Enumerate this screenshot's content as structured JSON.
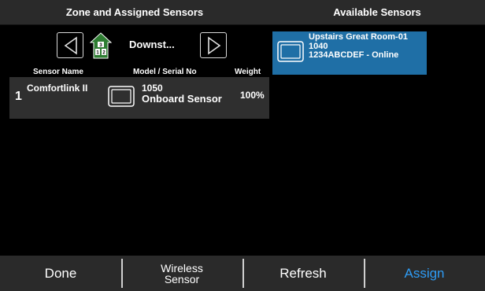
{
  "headers": {
    "left": "Zone and Assigned Sensors",
    "right": "Available Sensors"
  },
  "zone": {
    "name": "Downst...",
    "house_icon": "house-icon",
    "house_floor_top": "3",
    "house_floor_left": "1",
    "house_floor_right": "2"
  },
  "columns": {
    "name": "Sensor Name",
    "model": "Model / Serial No",
    "weight": "Weight"
  },
  "assigned": [
    {
      "number": "1",
      "name": "Comfortlink II",
      "model": "1050",
      "serial": "Onboard Sensor",
      "weight": "100%"
    }
  ],
  "available": [
    {
      "name": "Upstairs Great Room-01",
      "model": "1040",
      "status": "1234ABCDEF - Online"
    }
  ],
  "footer": {
    "done": "Done",
    "wireless_line1": "Wireless",
    "wireless_line2": "Sensor",
    "refresh": "Refresh",
    "assign": "Assign"
  },
  "colors": {
    "accent": "#2e9cf5",
    "selected": "#1f6fa6",
    "house": "#2e7d32"
  }
}
